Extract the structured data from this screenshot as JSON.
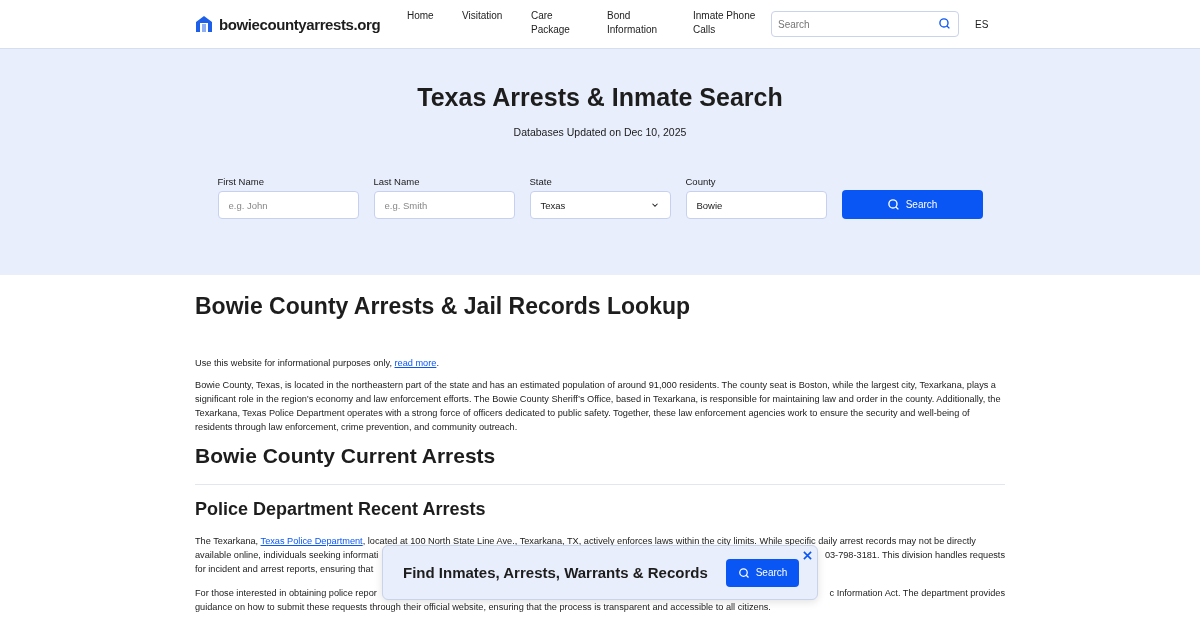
{
  "header": {
    "logo": "bowiecountyarrests.org",
    "nav": [
      {
        "label": "Home"
      },
      {
        "label": "Visitation"
      },
      {
        "label": "Care Package"
      },
      {
        "label": "Bond Information"
      },
      {
        "label": "Inmate Phone Calls"
      }
    ],
    "search": {
      "placeholder": "Search"
    },
    "language": "ES"
  },
  "hero": {
    "title": "Texas Arrests & Inmate Search",
    "subtitle": "Databases Updated on Dec 10, 2025",
    "fields": [
      {
        "kind": "input",
        "label": "First Name",
        "placeholder": "e.g. John"
      },
      {
        "kind": "input",
        "label": "Last Name",
        "placeholder": "e.g. Smith"
      },
      {
        "kind": "select",
        "label": "State",
        "value": "Texas"
      },
      {
        "kind": "input",
        "label": "County",
        "value": "Bowie"
      }
    ],
    "button": "Search"
  },
  "article": {
    "title": "Bowie County Arrests & Jail Records Lookup",
    "notice": {
      "text": "Use this website for informational purposes only, ",
      "link": "read more",
      "end": "."
    },
    "intro": "Bowie County, Texas, is located in the northeastern part of the state and has an estimated population of around 91,000 residents. The county seat is Boston, while the largest city, Texarkana, plays a significant role in the region’s economy and law enforcement efforts. The Bowie County Sheriff’s Office, based in Texarkana, is responsible for maintaining law and order in the county. Additionally, the Texarkana, Texas Police Department operates with a strong force of officers dedicated to public safety. Together, these law enforcement agencies work to ensure the security and well-being of residents through law enforcement, crime prevention, and community outreach.",
    "section_title": "Bowie County Current Arrests",
    "subsection_title": "Police Department Recent Arrests",
    "paragraphs": [
      {
        "lines": [
          {
            "before": "The Texarkana, ",
            "link": "Texas Police Department",
            "after": ", located at 100 North State Line Ave., Texarkana, TX, actively enforces laws within the city limits. While specific daily arrest records may not be directly"
          },
          {
            "left": "available online, individuals seeking informati",
            "right": "03-798-3181. This division handles requests"
          },
          {
            "left": "for incident and arrest reports, ensuring that"
          }
        ]
      },
      {
        "lines": [
          {
            "left": "For those interested in obtaining police repor",
            "right": "c Information Act. The department provides"
          },
          {
            "left": "guidance on how to submit these requests through their official website, ensuring that the process is transparent and accessible to all citizens."
          }
        ]
      }
    ]
  },
  "popup": {
    "title": "Find Inmates, Arrests, Warrants & Records",
    "button": "Search"
  }
}
